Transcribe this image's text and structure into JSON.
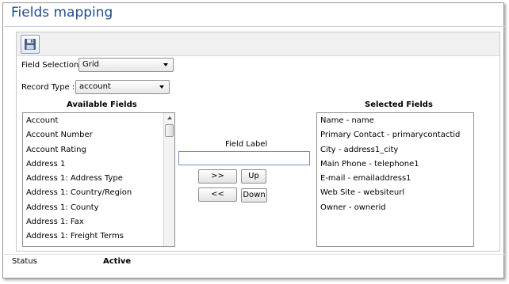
{
  "page": {
    "title": "Fields mapping"
  },
  "toolbar": {
    "save_icon": "floppy-disk-icon"
  },
  "field_selection": {
    "label": "Field Selection:",
    "value": "Grid"
  },
  "record_type": {
    "label": "Record Type :",
    "value": "account"
  },
  "available_fields": {
    "header": "Available Fields",
    "items": [
      "Account",
      "Account Number",
      "Account Rating",
      "Address 1",
      "Address 1: Address Type",
      "Address 1: Country/Region",
      "Address 1: County",
      "Address 1: Fax",
      "Address 1: Freight Terms"
    ]
  },
  "field_label": {
    "label": "Field Label",
    "value": ""
  },
  "buttons": {
    "add": ">>",
    "remove": "<<",
    "up": "Up",
    "down": "Down"
  },
  "selected_fields": {
    "header": "Selected Fields",
    "items": [
      "Name - name",
      "Primary Contact - primarycontactid",
      "City - address1_city",
      "Main Phone - telephone1",
      "E-mail - emailaddress1",
      "Web Site - websiteurl",
      "Owner - ownerid"
    ]
  },
  "status": {
    "label": "Status",
    "value": "Active"
  }
}
